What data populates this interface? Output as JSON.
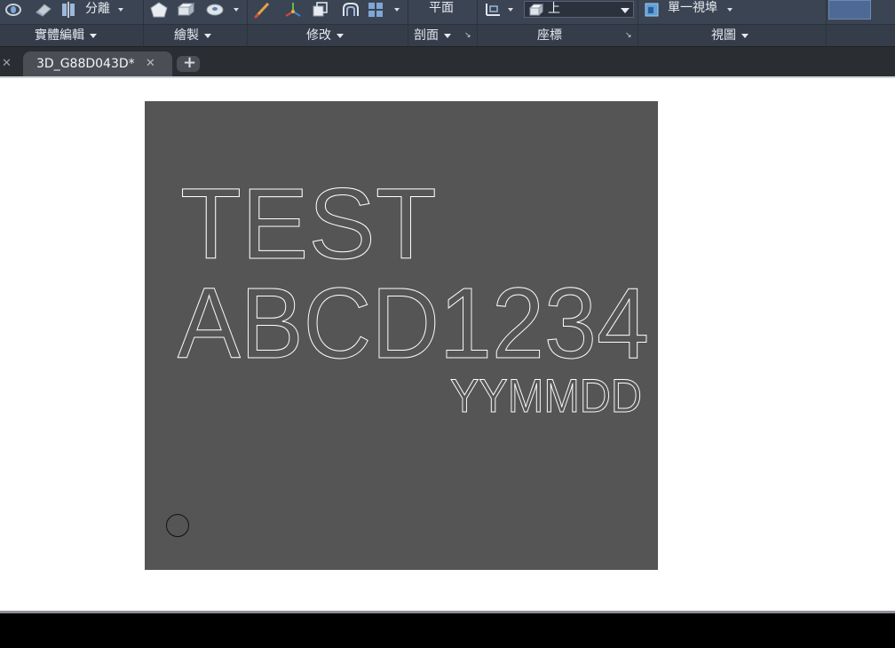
{
  "ribbon": {
    "top_labels": {
      "separate": "分離",
      "plan": "平面",
      "view_value": "上",
      "viewport": "單一視埠"
    },
    "panels": [
      {
        "label": "實體編輯",
        "has_dropdown": true
      },
      {
        "label": "繪製",
        "has_dropdown": true
      },
      {
        "label": "修改",
        "has_dropdown": true
      },
      {
        "label": "剖面",
        "has_dropdown": true
      },
      {
        "label": "座標",
        "has_dropdown": false
      },
      {
        "label": "視圖",
        "has_dropdown": true
      }
    ],
    "icons": [
      "ring-icon",
      "eraser-icon",
      "split-icon",
      "pentagon-icon",
      "box-draw-icon",
      "revolve-icon",
      "brush-icon",
      "move-3d-icon",
      "box-icon",
      "offset-icon",
      "array-icon",
      "ucs-icon",
      "view-cube-icon",
      "viewport-icon"
    ],
    "launcher_glyph": "↘",
    "swatch_color": "#4d6a96"
  },
  "tabs": {
    "active": {
      "title": "3D_G88D043D*",
      "close_glyph": "✕"
    },
    "close_left_glyph": "✕",
    "new_tab_glyph": "+"
  },
  "drawing": {
    "plate_color": "#555555",
    "lines": [
      "TEST",
      "ABCD1234",
      "YYMMDD"
    ],
    "marker": "pin-1-circle"
  }
}
